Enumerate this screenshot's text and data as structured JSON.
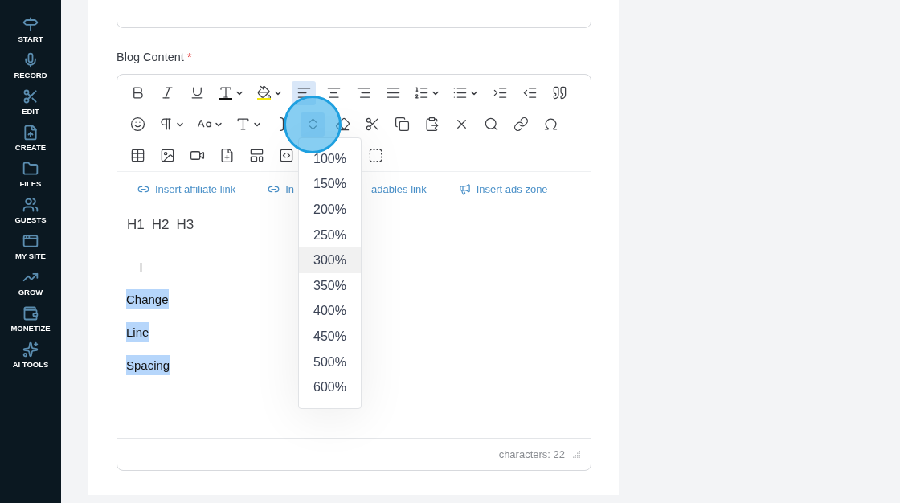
{
  "sidebar": {
    "items": [
      {
        "label": "START"
      },
      {
        "label": "RECORD"
      },
      {
        "label": "EDIT"
      },
      {
        "label": "CREATE"
      },
      {
        "label": "FILES"
      },
      {
        "label": "GUESTS"
      },
      {
        "label": "MY SITE"
      },
      {
        "label": "GROW"
      },
      {
        "label": "MONETIZE"
      },
      {
        "label": "AI TOOLS"
      }
    ]
  },
  "field_label": {
    "text": "Blog Content",
    "required_mark": "*"
  },
  "toolbar": {
    "rows": [
      [
        {
          "kind": "bold",
          "active": false
        },
        {
          "kind": "italic",
          "active": false
        },
        {
          "kind": "underline",
          "active": false
        },
        {
          "kind": "font-color",
          "active": false
        },
        {
          "kind": "highlight",
          "active": false
        },
        {
          "kind": "align-left",
          "active": true
        },
        {
          "kind": "align-center",
          "active": false
        },
        {
          "kind": "align-right",
          "active": false
        },
        {
          "kind": "justify",
          "active": false
        },
        {
          "kind": "ordered-list",
          "active": false
        },
        {
          "kind": "bullet-list",
          "active": false
        },
        {
          "kind": "indent",
          "active": false
        },
        {
          "kind": "outdent",
          "active": false
        },
        {
          "kind": "quote",
          "active": false
        }
      ],
      [
        {
          "kind": "emoji",
          "active": false
        },
        {
          "kind": "paragraph",
          "active": false
        },
        {
          "kind": "font-size",
          "active": false
        },
        {
          "kind": "font-family",
          "active": false
        },
        {
          "kind": "add-text",
          "active": false
        },
        {
          "kind": "line-height",
          "active": true
        },
        {
          "kind": "eraser",
          "active": false
        },
        {
          "kind": "cut",
          "active": false
        },
        {
          "kind": "copy",
          "active": false
        },
        {
          "kind": "paste",
          "active": false
        },
        {
          "kind": "clear-format",
          "active": false
        },
        {
          "kind": "find",
          "active": false
        },
        {
          "kind": "link",
          "active": false
        },
        {
          "kind": "special-char",
          "active": false
        }
      ],
      [
        {
          "kind": "table",
          "active": false
        },
        {
          "kind": "image",
          "active": false
        },
        {
          "kind": "video",
          "active": false
        },
        {
          "kind": "file",
          "active": false
        },
        {
          "kind": "template",
          "active": false
        },
        {
          "kind": "source",
          "active": false
        },
        {
          "kind": "show-blocks",
          "active": false
        }
      ]
    ]
  },
  "insert_links": [
    {
      "text": "Insert affiliate link"
    },
    {
      "text": "In",
      "text_after": "adables link"
    },
    {
      "text": "Insert ads zone"
    }
  ],
  "headings": [
    "H1",
    "H2",
    "H3"
  ],
  "content": {
    "lines": [
      "Change",
      "Line",
      "Spacing"
    ]
  },
  "footer": {
    "count": "characters: 22"
  },
  "line_height_menu": [
    {
      "label": "100%",
      "selected": false
    },
    {
      "label": "150%",
      "selected": false
    },
    {
      "label": "200%",
      "selected": false
    },
    {
      "label": "250%",
      "selected": false
    },
    {
      "label": "300%",
      "selected": true
    },
    {
      "label": "350%",
      "selected": false
    },
    {
      "label": "400%",
      "selected": false
    },
    {
      "label": "450%",
      "selected": false
    },
    {
      "label": "500%",
      "selected": false
    },
    {
      "label": "600%",
      "selected": false
    }
  ]
}
